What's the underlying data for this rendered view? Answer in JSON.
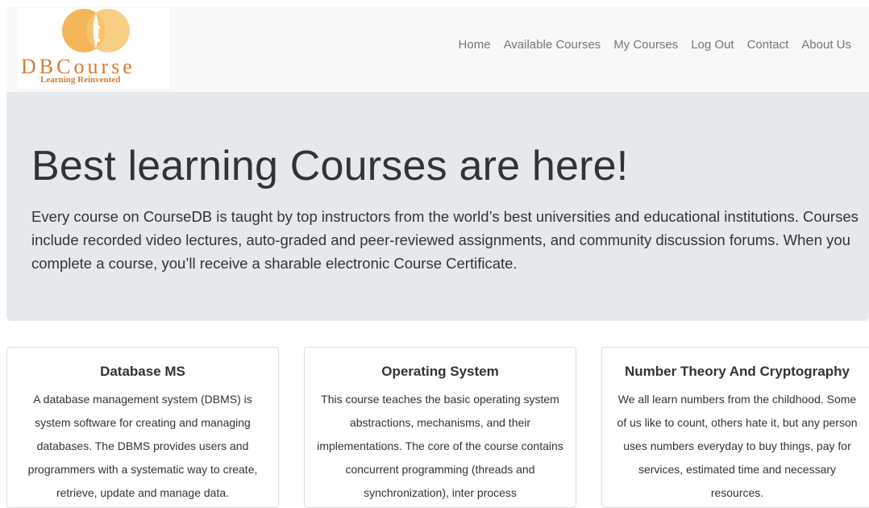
{
  "brand": {
    "name": "DBCourse",
    "tagline": "Learning Reinvented",
    "colors": {
      "circle_primary": "#f2a93b",
      "circle_secondary": "#f6c76f",
      "text": "#d67a33"
    }
  },
  "nav": {
    "items": [
      {
        "label": "Home"
      },
      {
        "label": "Available Courses"
      },
      {
        "label": "My Courses"
      },
      {
        "label": "Log Out"
      },
      {
        "label": "Contact"
      },
      {
        "label": "About Us"
      }
    ]
  },
  "hero": {
    "title": "Best learning Courses are here!",
    "text": "Every course on CourseDB is taught by top instructors from the world’s best universities and educational institutions. Courses include recorded video lectures, auto-graded and peer-reviewed assignments, and community discussion forums. When you complete a course, you’ll receive a sharable electronic Course Certificate."
  },
  "courses": [
    {
      "title": "Database MS",
      "description": "A database management system (DBMS) is system software for creating and managing databases. The DBMS provides users and programmers with a systematic way to create, retrieve, update and manage data."
    },
    {
      "title": "Operating System",
      "description": "This course teaches the basic operating system abstractions, mechanisms, and their implementations. The core of the course contains concurrent programming (threads and synchronization), inter process"
    },
    {
      "title": "Number Theory And Cryptography",
      "description": "We all learn numbers from the childhood. Some of us like to count, others hate it, but any person uses numbers everyday to buy things, pay for services, estimated time and necessary resources."
    }
  ]
}
